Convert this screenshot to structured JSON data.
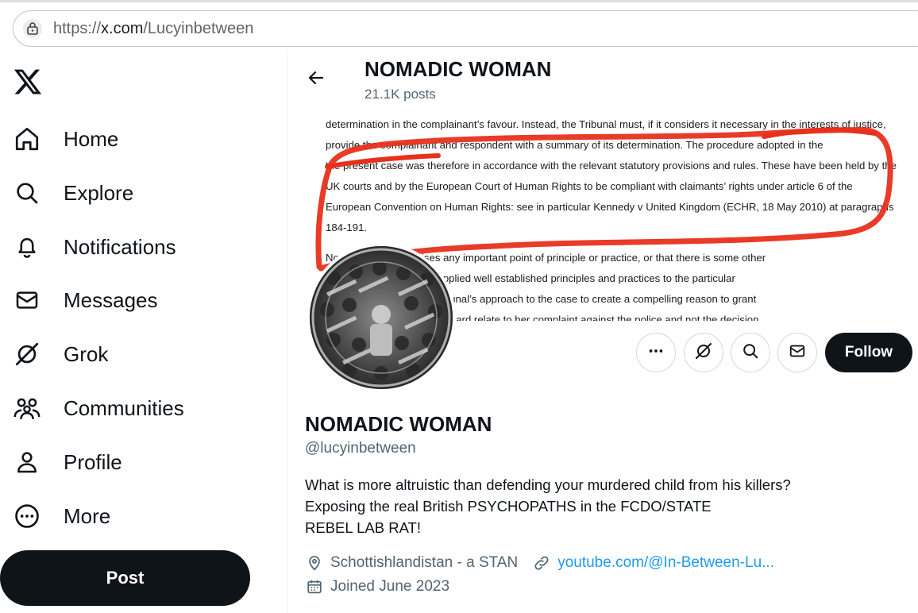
{
  "browser": {
    "url_prefix": "https://",
    "url_domain": "x.com",
    "url_path": "/Lucyinbetween"
  },
  "nav": {
    "items": [
      {
        "label": "Home",
        "icon": "home-icon"
      },
      {
        "label": "Explore",
        "icon": "search-icon"
      },
      {
        "label": "Notifications",
        "icon": "bell-icon"
      },
      {
        "label": "Messages",
        "icon": "envelope-icon"
      },
      {
        "label": "Grok",
        "icon": "grok-icon"
      },
      {
        "label": "Communities",
        "icon": "communities-icon"
      },
      {
        "label": "Profile",
        "icon": "person-icon"
      },
      {
        "label": "More",
        "icon": "more-circle-icon"
      }
    ],
    "post_label": "Post"
  },
  "header": {
    "title": "NOMADIC WOMAN",
    "posts_count": "21.1K posts"
  },
  "banner": {
    "document_lines": [
      "determination in the complainant’s favour. Instead, the Tribunal must, if it considers it necessary in the interests of justice,",
      "provide the complainant and respondent with a summary of its determination. The procedure adopted in the",
      "the present case was therefore in accordance with the relevant statutory provisions and rules. These have been held by the",
      "UK courts and by the European Court of Human Rights to be compliant with claimants’ rights under article 6 of the",
      "European Convention on Human Rights: see in particular Kennedy v United Kingdom (ECHR, 18 May 2010) at paragraphs",
      "184-191.",
      "No                           the application raises any important point of principle or practice, or that there is some other",
      "                                leave. The Tribunal has applied well established principles and practices to the particular",
      "                                   There is nothing in the Tribunal’s approach to the case to create a compelling reason to grant",
      "                                   n by the applicant in this regard relate to her complaint against the police and not the decision"
    ],
    "annotation_color": "#e8301c"
  },
  "actions": {
    "more_icon": "more-icon",
    "grok_icon": "grok-icon",
    "search_icon": "search-icon",
    "message_icon": "envelope-icon",
    "follow_label": "Follow"
  },
  "profile": {
    "name": "NOMADIC WOMAN",
    "handle": "@lucyinbetween",
    "bio_lines": [
      "What is more altruistic than defending your murdered child from his killers?",
      "Exposing the real British PSYCHOPATHS in the FCDO/STATE",
      "REBEL LAB RAT!"
    ],
    "location": "Schottishlandistan - a STAN",
    "website": "youtube.com/@In-Between-Lu...",
    "joined": "Joined June 2023"
  },
  "colors": {
    "text_primary": "#0f1419",
    "text_secondary": "#536471",
    "link": "#1d9bf0",
    "button_dark": "#0f1419"
  }
}
